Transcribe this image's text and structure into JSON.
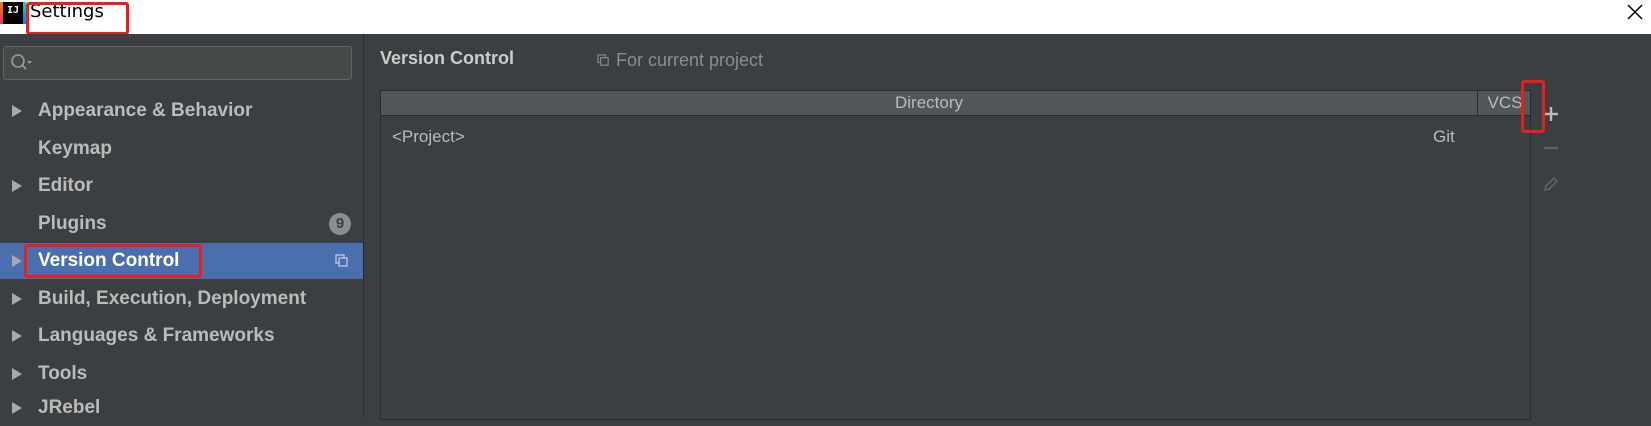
{
  "window": {
    "title": "Settings",
    "app_icon_text": "IJ",
    "close_icon": "close-icon"
  },
  "sidebar": {
    "search": {
      "placeholder": "",
      "value": ""
    },
    "items": [
      {
        "label": "Appearance & Behavior",
        "expandable": true
      },
      {
        "label": "Keymap",
        "expandable": false
      },
      {
        "label": "Editor",
        "expandable": true
      },
      {
        "label": "Plugins",
        "expandable": false,
        "badge": "9"
      },
      {
        "label": "Version Control",
        "expandable": true,
        "selected": true,
        "project_scope_icon": "copy-icon"
      },
      {
        "label": "Build, Execution, Deployment",
        "expandable": true
      },
      {
        "label": "Languages & Frameworks",
        "expandable": true
      },
      {
        "label": "Tools",
        "expandable": true
      },
      {
        "label": "JRebel",
        "expandable": true
      }
    ]
  },
  "main": {
    "title": "Version Control",
    "scope_label": "For current project",
    "table": {
      "columns": [
        "Directory",
        "VCS"
      ],
      "rows": [
        {
          "directory": "<Project>",
          "vcs": "Git"
        }
      ]
    },
    "toolbar": [
      "add-icon",
      "remove-icon",
      "edit-icon"
    ]
  },
  "colors": {
    "selection": "#4b6eaf",
    "highlight": "#e8201b",
    "background": "#3c3f41"
  }
}
